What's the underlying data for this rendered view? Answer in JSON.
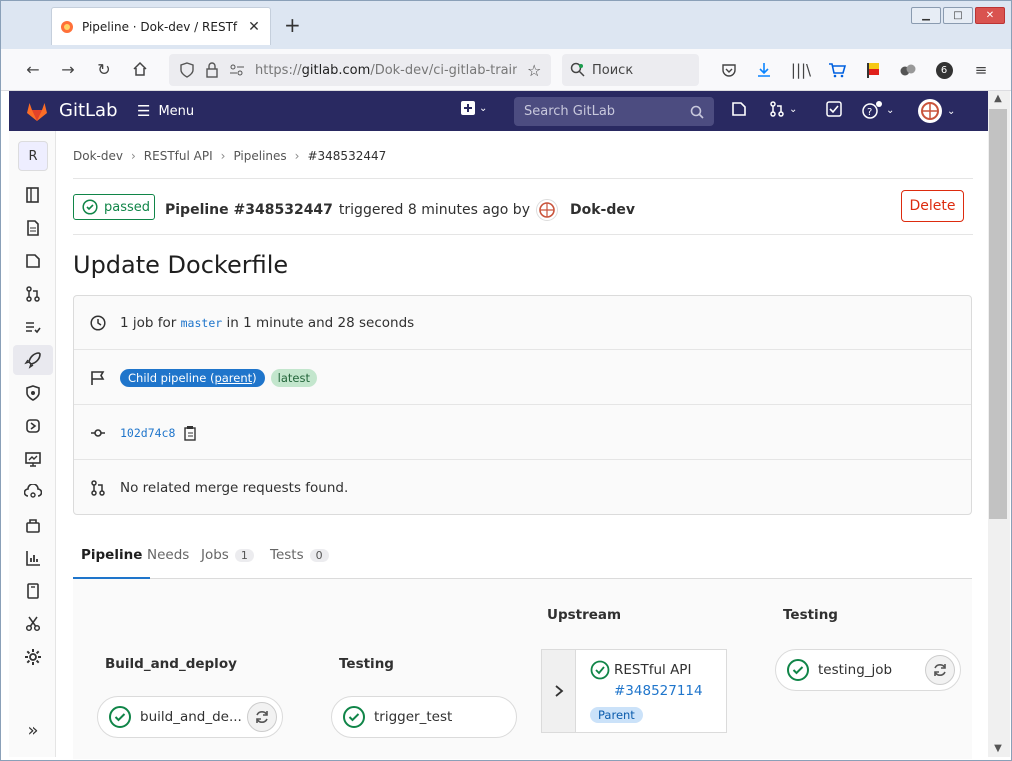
{
  "browser": {
    "tab_title": "Pipeline · Dok-dev / RESTful API",
    "url_prefix": "https://",
    "url_host": "gitlab.com",
    "url_path": "/Dok-dev/ci-gitlab-traini",
    "search_placeholder": "Поиск",
    "extension_badge": "6"
  },
  "gitlab": {
    "brand": "GitLab",
    "menu_label": "Menu",
    "search_placeholder": "Search GitLab"
  },
  "sidebar": {
    "project_letter": "R"
  },
  "breadcrumb": [
    "Dok-dev",
    "RESTful API",
    "Pipelines",
    "#348532447"
  ],
  "pipeline": {
    "status": "passed",
    "title_prefix": "Pipeline #348532447",
    "triggered_text": "triggered 8 minutes ago by",
    "user": "Dok-dev",
    "delete_label": "Delete",
    "commit_title": "Update Dockerfile",
    "jobs_text_before": "1 job for",
    "branch": "master",
    "jobs_text_after": "in 1 minute and 28 seconds",
    "child_label": "Child pipeline (",
    "parent_link": "parent",
    "child_label_end": ")",
    "latest_label": "latest",
    "commit_sha": "102d74c8",
    "merge_requests": "No related merge requests found."
  },
  "tabs": [
    {
      "label": "Pipeline",
      "count": null
    },
    {
      "label": "Needs",
      "count": null
    },
    {
      "label": "Jobs",
      "count": "1"
    },
    {
      "label": "Tests",
      "count": "0"
    }
  ],
  "graph": {
    "stages": [
      {
        "name": "Build_and_deploy",
        "job": "build_and_de..."
      },
      {
        "name": "Testing",
        "job": "trigger_test"
      }
    ],
    "upstream": {
      "heading": "Upstream",
      "project": "RESTful API",
      "pipeline_id": "#348527114",
      "badge": "Parent"
    },
    "downstream": {
      "heading": "Testing",
      "job": "testing_job"
    }
  },
  "colors": {
    "header_bg": "#292961",
    "success": "#108548",
    "link": "#1f75cb",
    "danger": "#dd2b0e"
  }
}
